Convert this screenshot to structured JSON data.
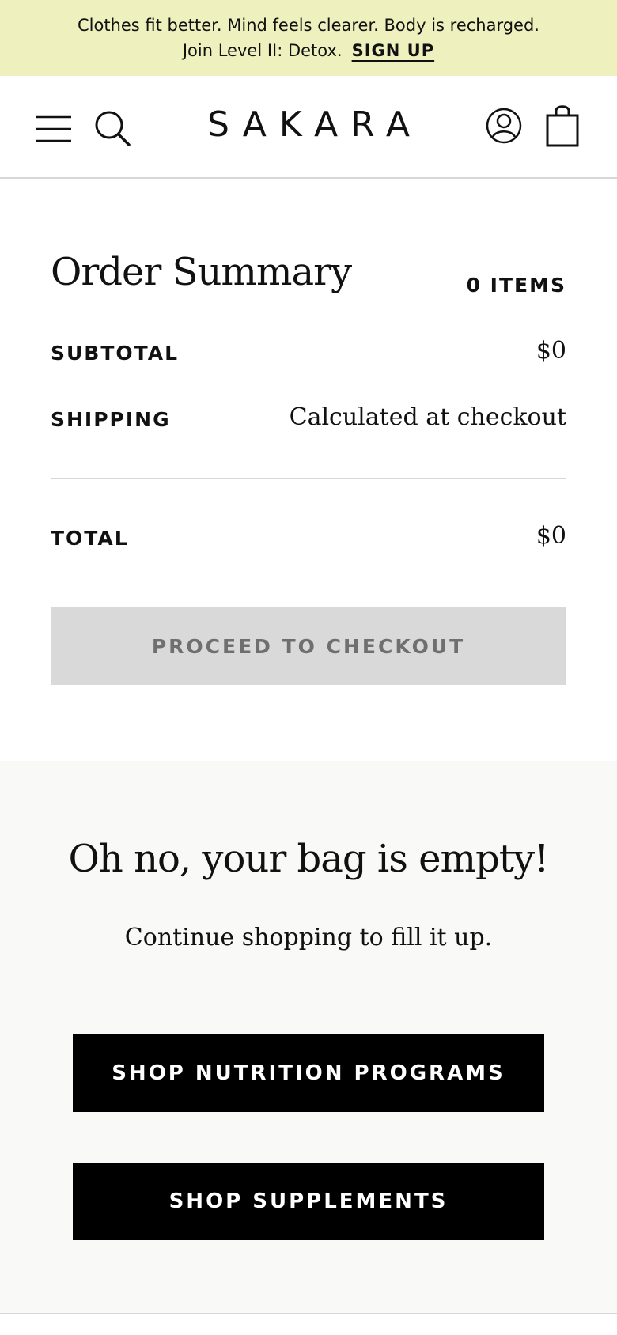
{
  "promo": {
    "line1": "Clothes fit better. Mind feels clearer. Body is recharged.",
    "line2": "Join Level II: Detox.",
    "cta": "SIGN UP",
    "background": "#eef0bd"
  },
  "header": {
    "logo": "SAKARA",
    "icons": [
      "menu-icon",
      "search-icon",
      "account-icon",
      "bag-icon"
    ]
  },
  "summary": {
    "title": "Order Summary",
    "items_count": "0 ITEMS",
    "subtotal_label": "SUBTOTAL",
    "subtotal_value": "$0",
    "shipping_label": "SHIPPING",
    "shipping_value": "Calculated at checkout",
    "total_label": "TOTAL",
    "total_value": "$0",
    "checkout_label": "PROCEED TO CHECKOUT"
  },
  "empty": {
    "title": "Oh no, your bag is empty!",
    "subtitle": "Continue shopping to fill it up.",
    "buttons": [
      {
        "label": "SHOP NUTRITION PROGRAMS"
      },
      {
        "label": "SHOP SUPPLEMENTS"
      }
    ]
  }
}
